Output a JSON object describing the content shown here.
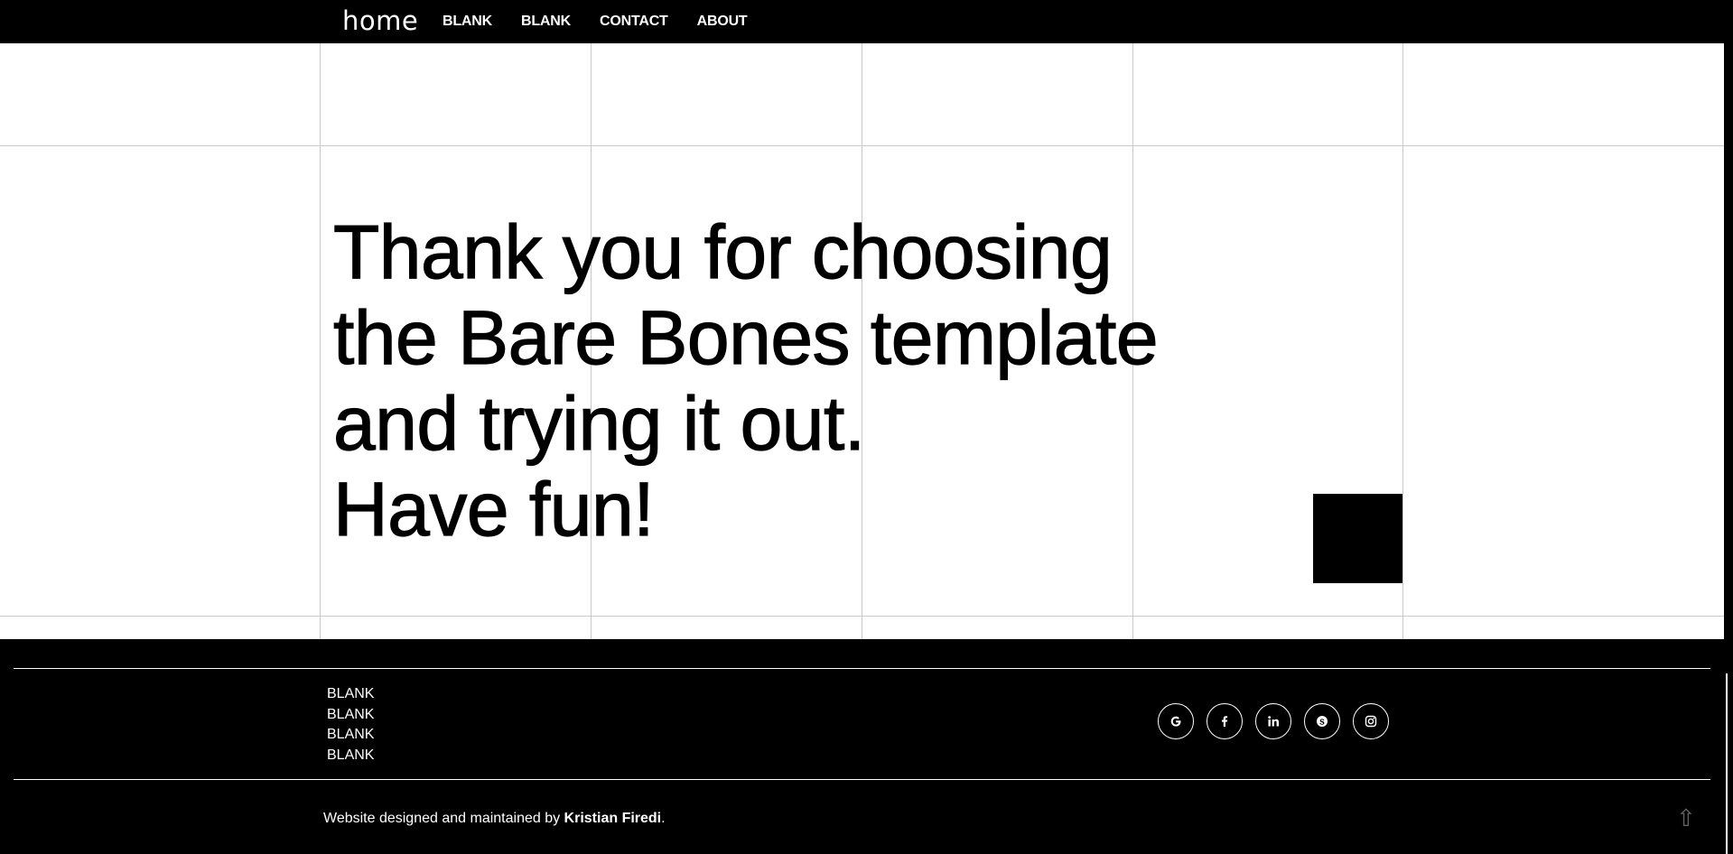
{
  "nav": {
    "brand": "home",
    "links": [
      {
        "label": "BLANK"
      },
      {
        "label": "BLANK"
      },
      {
        "label": "CONTACT"
      },
      {
        "label": "ABOUT"
      }
    ]
  },
  "hero": {
    "lines": [
      "Thank you for choosing",
      "the Bare Bones template",
      "and trying it out.",
      "Have fun!"
    ]
  },
  "footer": {
    "links": [
      {
        "label": "BLANK"
      },
      {
        "label": "BLANK"
      },
      {
        "label": "BLANK"
      },
      {
        "label": "BLANK"
      }
    ],
    "social": [
      {
        "icon": "google-icon"
      },
      {
        "icon": "facebook-icon"
      },
      {
        "icon": "linkedin-icon"
      },
      {
        "icon": "skype-icon"
      },
      {
        "icon": "instagram-icon"
      }
    ],
    "credit_prefix": "Website designed and maintained by ",
    "credit_author": "Kristian Firedi",
    "credit_suffix": ".",
    "to_top_icon": "⇧"
  },
  "colors": {
    "background": "#000000",
    "content": "#ffffff",
    "grid_line": "#c8c8c8"
  }
}
